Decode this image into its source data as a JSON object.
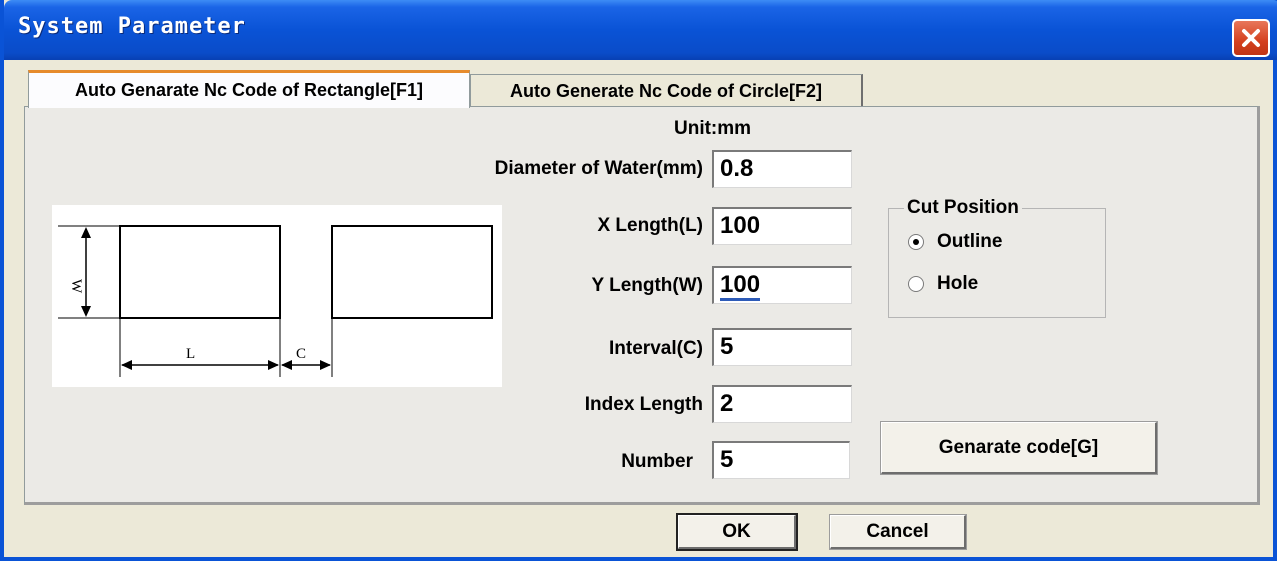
{
  "window": {
    "title": "System Parameter"
  },
  "tabs": [
    {
      "label": "Auto Genarate Nc Code of Rectangle[F1]",
      "active": true
    },
    {
      "label": "Auto Generate Nc Code of Circle[F2]",
      "active": false
    }
  ],
  "form": {
    "unit_label": "Unit:mm",
    "diameter": {
      "label": "Diameter of Water(mm)",
      "value": "0.8"
    },
    "x_length": {
      "label": "X Length(L)",
      "value": "100"
    },
    "y_length": {
      "label": "Y Length(W)",
      "value": "100"
    },
    "interval": {
      "label": "Interval(C)",
      "value": "5"
    },
    "index_length": {
      "label": "Index Length",
      "value": "2"
    },
    "number": {
      "label": "Number",
      "value": "5"
    }
  },
  "cut_position": {
    "title": "Cut Position",
    "options": [
      {
        "label": "Outline",
        "selected": true
      },
      {
        "label": "Hole",
        "selected": false
      }
    ]
  },
  "diagram": {
    "w_label": "W",
    "l_label": "L",
    "c_label": "C"
  },
  "buttons": {
    "generate": "Genarate code[G]",
    "ok": "OK",
    "cancel": "Cancel"
  },
  "colors": {
    "titlebar": "#0a53d6",
    "close": "#d4401e",
    "tab_highlight": "#e68b2c"
  }
}
